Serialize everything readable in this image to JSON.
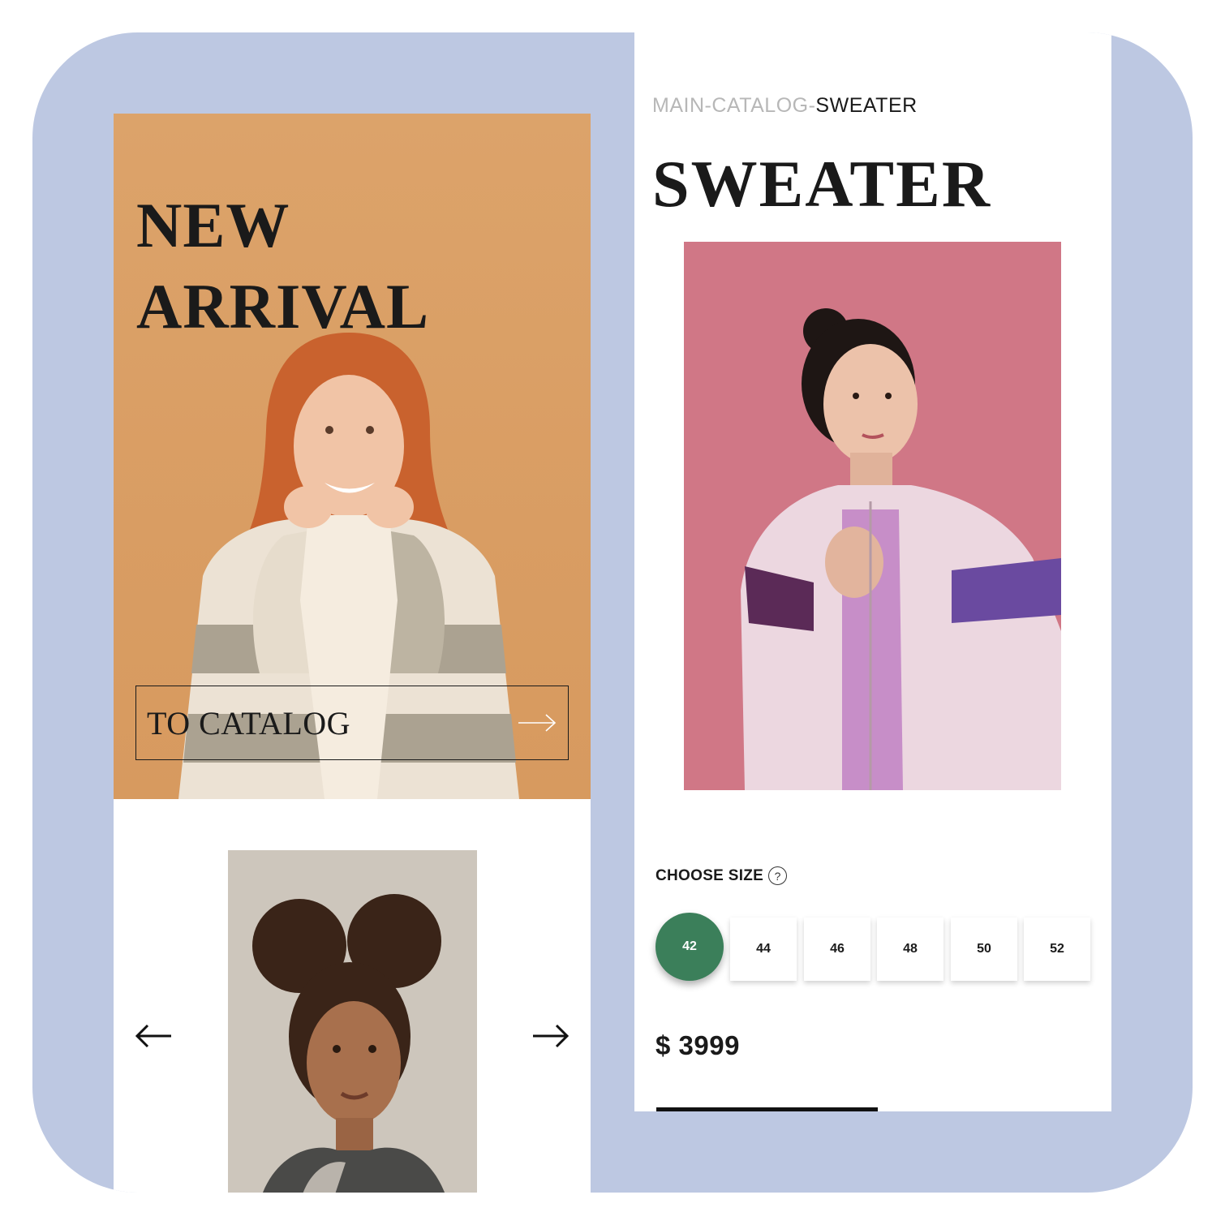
{
  "colors": {
    "frame_background": "#bdc8e2",
    "hero_background": "#d99d63",
    "selected_size": "#3b7f5a",
    "product_background": "#d47c8c"
  },
  "left_screen": {
    "hero": {
      "title_line1": "NEW",
      "title_line2": "ARRIVAL",
      "image": "model-in-striped-sweater"
    },
    "catalog_button": {
      "label": "TO CATALOG",
      "icon": "arrow-right-icon"
    },
    "carousel": {
      "prev_icon": "arrow-left-icon",
      "next_icon": "arrow-right-icon",
      "image": "model-with-curly-buns"
    }
  },
  "right_screen": {
    "breadcrumb": {
      "part1": "MAIN-",
      "part2": "CATALOG-",
      "current": "SWEATER"
    },
    "product": {
      "title": "SWEATER",
      "image": "model-in-color-block-jacket"
    },
    "size": {
      "label": "CHOOSE SIZE",
      "help_icon": "question-circle-icon",
      "options": [
        "42",
        "44",
        "46",
        "48",
        "50",
        "52"
      ],
      "selected": "42"
    },
    "price": "$ 3999"
  }
}
